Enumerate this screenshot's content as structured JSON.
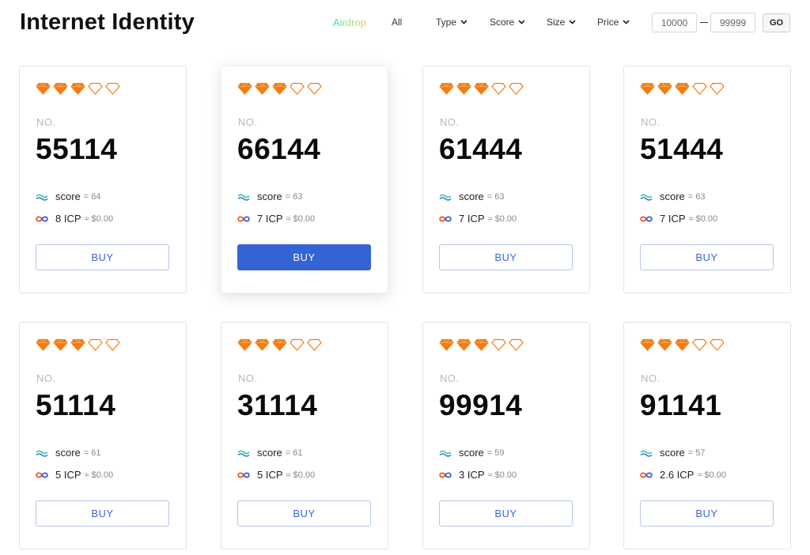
{
  "header": {
    "title": "Internet Identity",
    "nav_airdrop": "Airdrop",
    "nav_all": "All",
    "filters": [
      "Type",
      "Score",
      "Size",
      "Price"
    ],
    "range_min": "10000",
    "range_max": "99999",
    "go_label": "GO"
  },
  "card_common": {
    "no_label": "NO.",
    "score_label": "score",
    "buy_label": "BUY"
  },
  "colors": {
    "gem_fill": "#f57c12",
    "gem_outline": "#f57c12",
    "buy_primary": "#3463d6",
    "buy_border": "#b7c6e9"
  },
  "cards": [
    {
      "rating": 3,
      "rating_max": 5,
      "number": "55114",
      "score": "= 64",
      "price": "8 ICP",
      "usd": "≈ $0.00"
    },
    {
      "rating": 3,
      "rating_max": 5,
      "number": "66144",
      "score": "= 63",
      "price": "7 ICP",
      "usd": "≈ $0.00",
      "active": true
    },
    {
      "rating": 3,
      "rating_max": 5,
      "number": "61444",
      "score": "= 63",
      "price": "7 ICP",
      "usd": "≈ $0.00"
    },
    {
      "rating": 3,
      "rating_max": 5,
      "number": "51444",
      "score": "= 63",
      "price": "7 ICP",
      "usd": "≈ $0.00"
    },
    {
      "rating": 3,
      "rating_max": 5,
      "number": "51114",
      "score": "= 61",
      "price": "5 ICP",
      "usd": "≈ $0.00"
    },
    {
      "rating": 3,
      "rating_max": 5,
      "number": "31114",
      "score": "= 61",
      "price": "5 ICP",
      "usd": "≈ $0.00"
    },
    {
      "rating": 3,
      "rating_max": 5,
      "number": "99914",
      "score": "= 59",
      "price": "3 ICP",
      "usd": "≈ $0.00"
    },
    {
      "rating": 3,
      "rating_max": 5,
      "number": "91141",
      "score": "= 57",
      "price": "2.6 ICP",
      "usd": "≈ $0.00"
    }
  ],
  "icons": {
    "score": "wave-icon",
    "price": "infinity-icon",
    "rating": "diamond-icon",
    "dropdown": "chevron-down-icon"
  }
}
